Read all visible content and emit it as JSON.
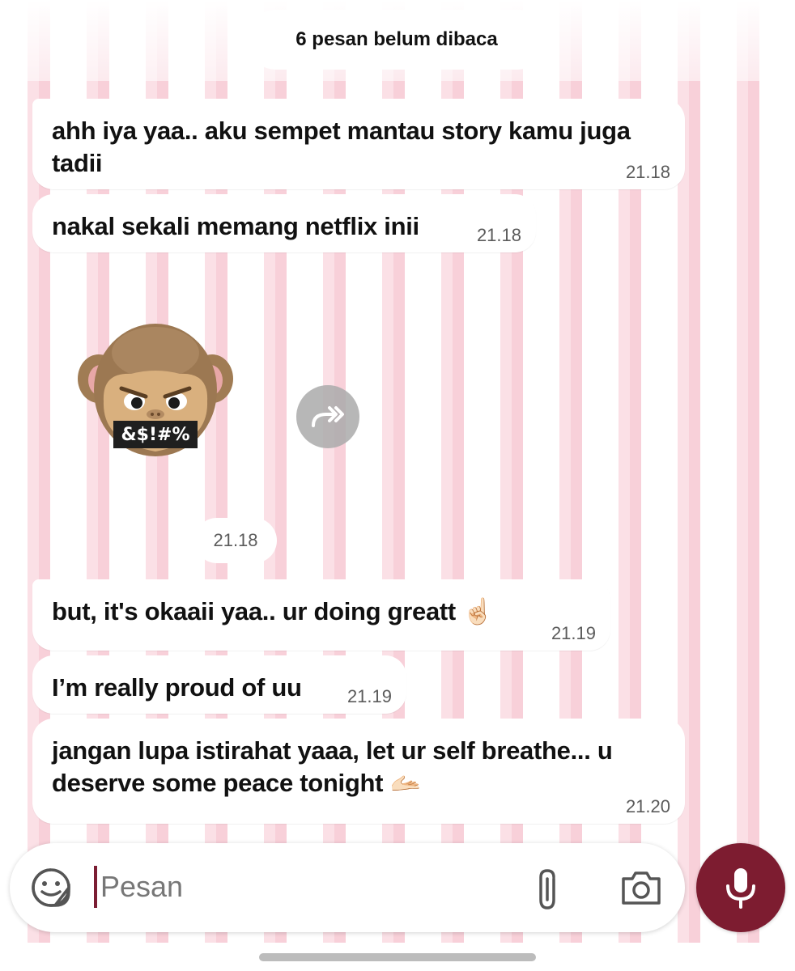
{
  "chat": {
    "unread_banner": "6 pesan belum dibaca",
    "messages": [
      {
        "text": "ahh iya yaa.. aku sempet mantau story kamu juga tadii",
        "time": "21.18"
      },
      {
        "text": "nakal sekali memang netflix inii",
        "time": "21.18"
      },
      {
        "sticker": "monkey-memoji-censored",
        "sticker_text": "&$!#%",
        "time": "21.18"
      },
      {
        "text": "but, it's okaaii yaa.. ur doing greatt ☝🏻",
        "time": "21.19"
      },
      {
        "text": "I’m really proud of uu",
        "time": "21.19"
      },
      {
        "text": "jangan lupa istirahat yaaa, let ur self breathe... u deserve some peace tonight 🫴🏻",
        "time": "21.20"
      }
    ]
  },
  "composer": {
    "placeholder": "Pesan",
    "icons": [
      "sticker-emoji-icon",
      "paperclip-icon",
      "camera-icon",
      "microphone-icon"
    ]
  },
  "colors": {
    "accent": "#7d1c30",
    "wallpaper_pink": "#f8d0d9",
    "bubble": "#ffffff"
  }
}
